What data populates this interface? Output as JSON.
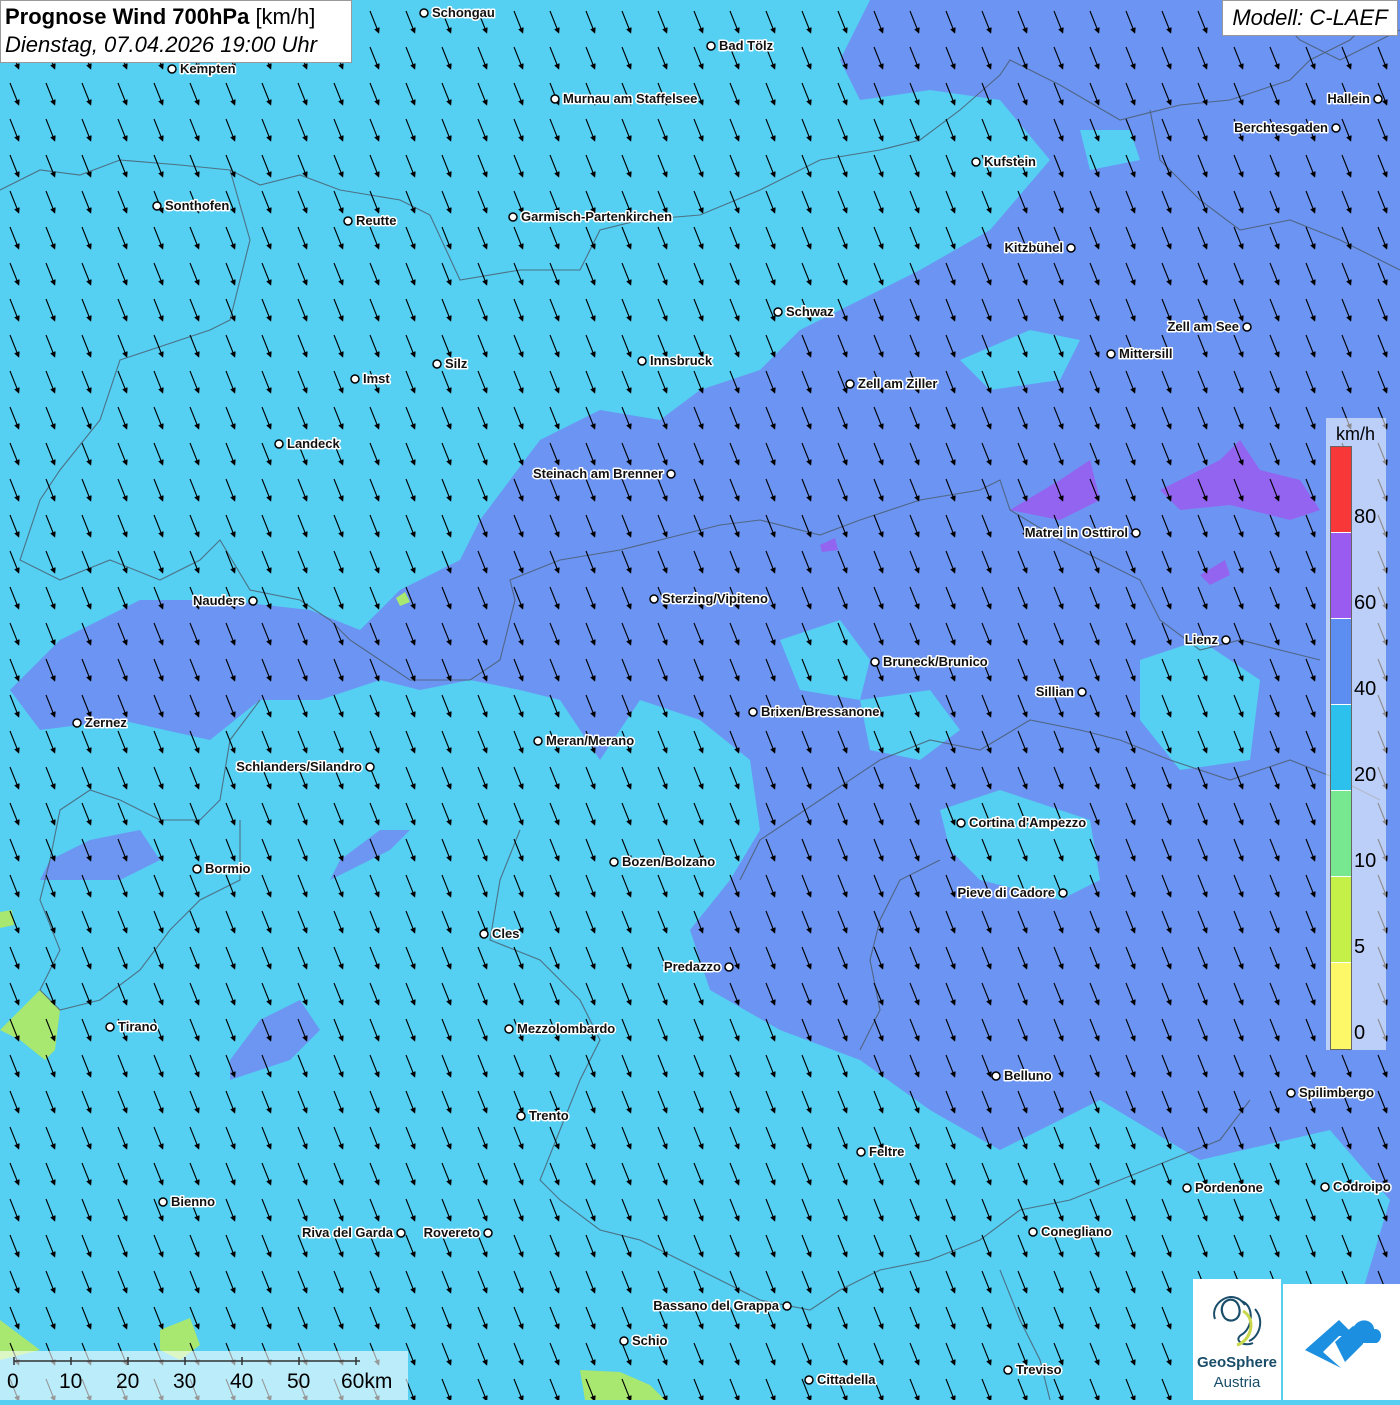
{
  "title": {
    "main": "Prognose Wind 700hPa",
    "unit": "[km/h]",
    "datetime": "Dienstag, 07.04.2026 19:00 Uhr"
  },
  "model": "Modell: C-LAEF",
  "legend": {
    "unit": "km/h",
    "labels": [
      "80",
      "60",
      "40",
      "20",
      "10",
      "5",
      "0"
    ],
    "colors": [
      "#f83838",
      "#9a5cf0",
      "#5c8ef2",
      "#2cc0ec",
      "#78e890",
      "#c4f048",
      "#fcf868"
    ]
  },
  "scale_bar": {
    "labels": [
      "0",
      "10",
      "20",
      "30",
      "40",
      "50",
      "60km"
    ]
  },
  "logos": {
    "geosphere_line1": "GeoSphere",
    "geosphere_line2": "Austria"
  },
  "colors": {
    "band_20_40": "#55cff2",
    "band_40_60": "#6f8ff2",
    "band_60_80": "#9a5cf0",
    "band_5_10": "#a8e870"
  },
  "wind": {
    "direction": "from north-northwest",
    "speed_range_kmh": "20-60"
  },
  "cities": [
    {
      "name": "Schongau"
    },
    {
      "name": "Bad Tölz"
    },
    {
      "name": "Kempten"
    },
    {
      "name": "Hallein"
    },
    {
      "name": "Murnau am Staffelsee"
    },
    {
      "name": "Berchtesgaden"
    },
    {
      "name": "Kufstein"
    },
    {
      "name": "Sonthofen"
    },
    {
      "name": "Reutte"
    },
    {
      "name": "Garmisch-Partenkirchen"
    },
    {
      "name": "Kitzbühel"
    },
    {
      "name": "Schwaz"
    },
    {
      "name": "Zell am See"
    },
    {
      "name": "Mittersill"
    },
    {
      "name": "Silz"
    },
    {
      "name": "Innsbruck"
    },
    {
      "name": "Imst"
    },
    {
      "name": "Zell am Ziller"
    },
    {
      "name": "Landeck"
    },
    {
      "name": "Steinach am Brenner"
    },
    {
      "name": "Matrei in Osttirol"
    },
    {
      "name": "Nauders"
    },
    {
      "name": "Sterzing/Vipiteno"
    },
    {
      "name": "Lienz"
    },
    {
      "name": "Bruneck/Brunico"
    },
    {
      "name": "Sillian"
    },
    {
      "name": "Brixen/Bressanone"
    },
    {
      "name": "Zernez"
    },
    {
      "name": "Meran/Merano"
    },
    {
      "name": "Schlanders/Silandro"
    },
    {
      "name": "Cortina d'Ampezzo"
    },
    {
      "name": "Bozen/Bolzano"
    },
    {
      "name": "Bormio"
    },
    {
      "name": "Pieve di Cadore"
    },
    {
      "name": "Cles"
    },
    {
      "name": "Predazzo"
    },
    {
      "name": "Tirano"
    },
    {
      "name": "Mezzolombardo"
    },
    {
      "name": "Belluno"
    },
    {
      "name": "Spilimbergo"
    },
    {
      "name": "Trento"
    },
    {
      "name": "Feltre"
    },
    {
      "name": "Pordenone"
    },
    {
      "name": "Codroipo"
    },
    {
      "name": "Bienno"
    },
    {
      "name": "Riva del Garda"
    },
    {
      "name": "Rovereto"
    },
    {
      "name": "Conegliano"
    },
    {
      "name": "Bassano del Grappa"
    },
    {
      "name": "Schio"
    },
    {
      "name": "Treviso"
    },
    {
      "name": "Cittadella"
    }
  ]
}
